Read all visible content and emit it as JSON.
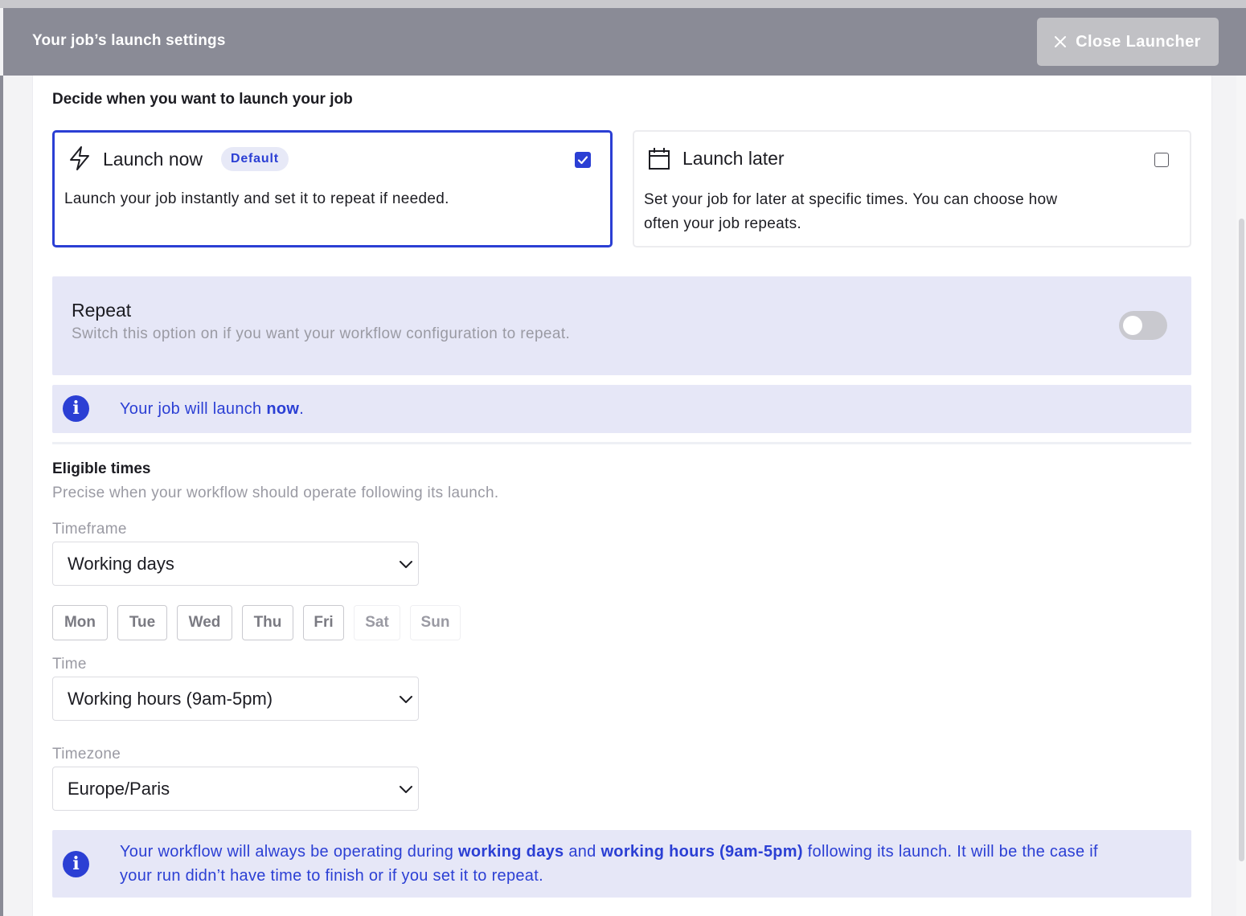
{
  "header": {
    "title": "Your job’s launch settings",
    "close_label": "Close Launcher"
  },
  "launch": {
    "question": "Decide when you want to launch your job",
    "now": {
      "title": "Launch now",
      "badge": "Default",
      "description": "Launch your job instantly and set it to repeat if needed.",
      "checked": true,
      "icon": "lightning-icon"
    },
    "later": {
      "title": "Launch later",
      "description_line1": "Set your job for later at specific times. You can choose how",
      "description_line2": "often your job repeats.",
      "checked": false,
      "icon": "calendar-icon"
    }
  },
  "repeat": {
    "title": "Repeat",
    "subtitle": "Switch this option on if you want your workflow configuration to repeat.",
    "enabled": false
  },
  "launch_info": {
    "prefix": "Your job will launch ",
    "emphasis": "now",
    "suffix": "."
  },
  "eligible": {
    "title": "Eligible times",
    "subtitle": "Precise when your workflow should operate following its launch.",
    "timeframe_label": "Timeframe",
    "timeframe_value": "Working days",
    "days": [
      {
        "label": "Mon",
        "selected": true
      },
      {
        "label": "Tue",
        "selected": true
      },
      {
        "label": "Wed",
        "selected": true
      },
      {
        "label": "Thu",
        "selected": true
      },
      {
        "label": "Fri",
        "selected": true
      },
      {
        "label": "Sat",
        "selected": false
      },
      {
        "label": "Sun",
        "selected": false
      }
    ],
    "time_label": "Time",
    "time_value": "Working hours (9am-5pm)",
    "timezone_label": "Timezone",
    "timezone_value": "Europe/Paris"
  },
  "operating_info": {
    "t1": "Your workflow will always be operating during ",
    "b1": "working days",
    "t2": " and ",
    "b2": "working hours (9am-5pm)",
    "t3": " following its launch. It will be the case if",
    "line2": "your run didn’t have time to finish or if you set it to repeat."
  },
  "colors": {
    "accent": "#2b3fd4",
    "header_bg": "#8a8b96",
    "info_bg": "#e6e7f7"
  }
}
